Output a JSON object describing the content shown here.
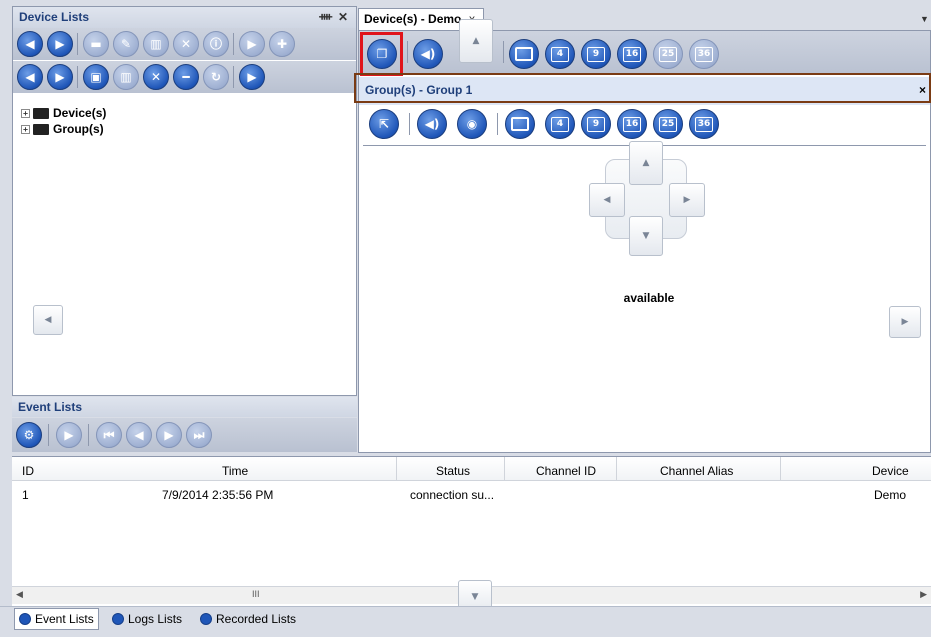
{
  "device_panel": {
    "title": "Device Lists",
    "pin_icon": "pin-icon",
    "close_icon": "close-icon",
    "tree": [
      {
        "label": "Device(s)"
      },
      {
        "label": "Group(s)"
      }
    ]
  },
  "viewer": {
    "tab_label": "Device(s) - Demo",
    "tab_close": "x",
    "group_title": "Group(s) - Group 1",
    "group_close": "×",
    "status_text": "available",
    "layout_numbers": [
      "4",
      "9",
      "16",
      "25",
      "36"
    ]
  },
  "event_panel": {
    "title": "Event Lists",
    "columns": [
      "ID",
      "Time",
      "Status",
      "Channel ID",
      "Channel Alias",
      "Device"
    ],
    "rows": [
      {
        "id": "1",
        "time": "7/9/2014 2:35:56 PM",
        "status": "connection su...",
        "channel_id": "",
        "channel_alias": "",
        "device": "Demo"
      }
    ],
    "scroll_mark": "III"
  },
  "bottom_tabs": [
    "Event Lists",
    "Logs Lists",
    "Recorded Lists"
  ],
  "colors": {
    "accent_blue": "#1f56b8",
    "highlight_red": "#e0141b",
    "highlight_brown": "#7a3b14"
  }
}
